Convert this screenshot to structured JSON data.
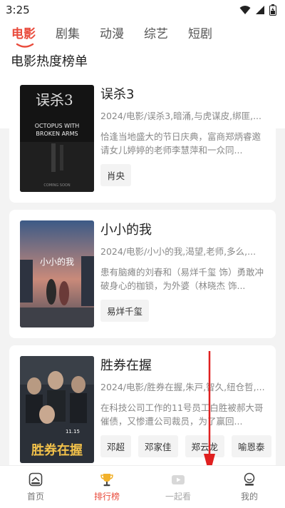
{
  "status_bar": {
    "time": "3:25",
    "icons": [
      "wifi-icon",
      "signal-icon",
      "battery-icon"
    ]
  },
  "tabs": [
    {
      "label": "电影",
      "active": true
    },
    {
      "label": "剧集",
      "active": false
    },
    {
      "label": "动漫",
      "active": false
    },
    {
      "label": "综艺",
      "active": false
    },
    {
      "label": "短剧",
      "active": false
    }
  ],
  "section_title": "电影热度榜单",
  "movies": [
    {
      "title": "误杀3",
      "meta": "2024/电影/误杀3,暗涌,与虎谋皮,绑匪,...",
      "desc": "恰逢当地盛大的节日庆典，富商郑炳睿邀请女儿婷婷的老师李慧萍和一众同...",
      "actors": [
        "肖央"
      ],
      "poster_lines": [
        "误杀3",
        "OCTOPUS WITH",
        "BROKEN ARMS",
        "COMING SOON"
      ]
    },
    {
      "title": "小小的我",
      "meta": "2024/电影/小小的我,渴望,老师,多么,...",
      "desc": "患有脑瘫的刘春和（易烊千玺 饰）勇敢冲破身心的枷锁，为外婆（林晓杰 饰...",
      "actors": [
        "易烊千玺"
      ],
      "poster_lines": [
        "小小的我"
      ]
    },
    {
      "title": "胜券在握",
      "meta": "2024/电影/胜券在握,朱戸,智久,纽仓哲,...",
      "desc": "在科技公司工作的11号员工白胜被郝大哥催债，又惨遭公司裁员，为了赢回...",
      "actors": [
        "邓超",
        "邓家佳",
        "郑云龙",
        "喻恩泰"
      ],
      "poster_lines": [
        "11.15",
        "胜券在握"
      ]
    }
  ],
  "bottom_nav": [
    {
      "label": "首页",
      "icon": "home-icon",
      "state": "normal"
    },
    {
      "label": "排行榜",
      "icon": "trophy-icon",
      "state": "active"
    },
    {
      "label": "一起看",
      "icon": "video-icon",
      "state": "disabled"
    },
    {
      "label": "我的",
      "icon": "profile-icon",
      "state": "normal"
    }
  ],
  "colors": {
    "accent": "#e94b3c",
    "annotation_arrow": "#e02020"
  }
}
